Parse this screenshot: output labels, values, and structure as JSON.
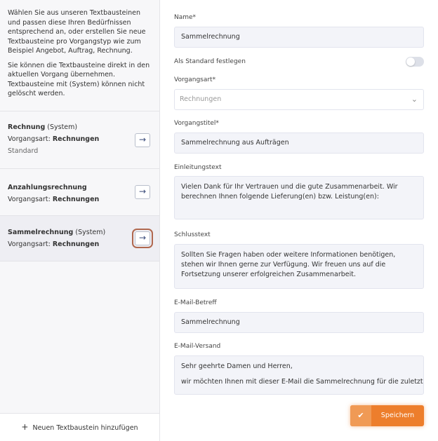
{
  "sidebar": {
    "intro_p1": "Wählen Sie aus unseren Textbausteinen und passen diese Ihren Bedürfnissen entsprechend an, oder erstellen Sie neue Textbausteine pro Vorgangstyp wie zum Beispiel Angebot, Auftrag, Rechnung.",
    "intro_p2": "Sie können die Textbausteine direkt in den aktuellen Vorgang übernehmen. Textbausteine mit (System) können nicht gelöscht werden.",
    "items": [
      {
        "title": "Rechnung",
        "system": " (System)",
        "type_label": "Vorgangsart: ",
        "type": "Rechnungen",
        "sub": "Standard"
      },
      {
        "title": "Anzahlungsrechnung",
        "system": "",
        "type_label": "Vorgangsart: ",
        "type": "Rechnungen",
        "sub": ""
      },
      {
        "title": "Sammelrechnung",
        "system": " (System)",
        "type_label": "Vorgangsart: ",
        "type": "Rechnungen",
        "sub": ""
      }
    ],
    "arrow_glyph": "→",
    "add_plus": "+",
    "add_label": "Neuen Textbaustein hinzufügen"
  },
  "form": {
    "name_label": "Name*",
    "name_value": "Sammelrechnung",
    "default_label": "Als Standard festlegen",
    "default_on": false,
    "type_label": "Vorgangsart*",
    "type_value": "Rechnungen",
    "title_label": "Vorgangstitel*",
    "title_value": "Sammelrechnung aus Aufträgen",
    "intro_label": "Einleitungstext",
    "intro_value": "Vielen Dank für Ihr Vertrauen und die gute Zusammenarbeit. Wir berechnen Ihnen folgende Lieferung(en) bzw. Leistung(en):",
    "closing_label": "Schlusstext",
    "closing_value": "Sollten Sie Fragen haben oder weitere Informationen benötigen, stehen wir Ihnen gerne zur Verfügung. Wir freuen uns auf die Fortsetzung unserer erfolgreichen Zusammenarbeit.",
    "subject_label": "E-Mail-Betreff",
    "subject_value": "Sammelrechnung",
    "mail_label": "E-Mail-Versand",
    "mail_line1": "Sehr geehrte Damen und Herren,",
    "mail_line2": "wir möchten Ihnen mit dieser E-Mail die Sammelrechnung für die zuletzt",
    "save_label": "Speichern",
    "save_icon": "✔",
    "chevron": "⌄"
  },
  "colors": {
    "accent": "#ed7e2c",
    "field_bg": "#f3f4f9",
    "sidebar_bg": "#f7f7f9"
  }
}
